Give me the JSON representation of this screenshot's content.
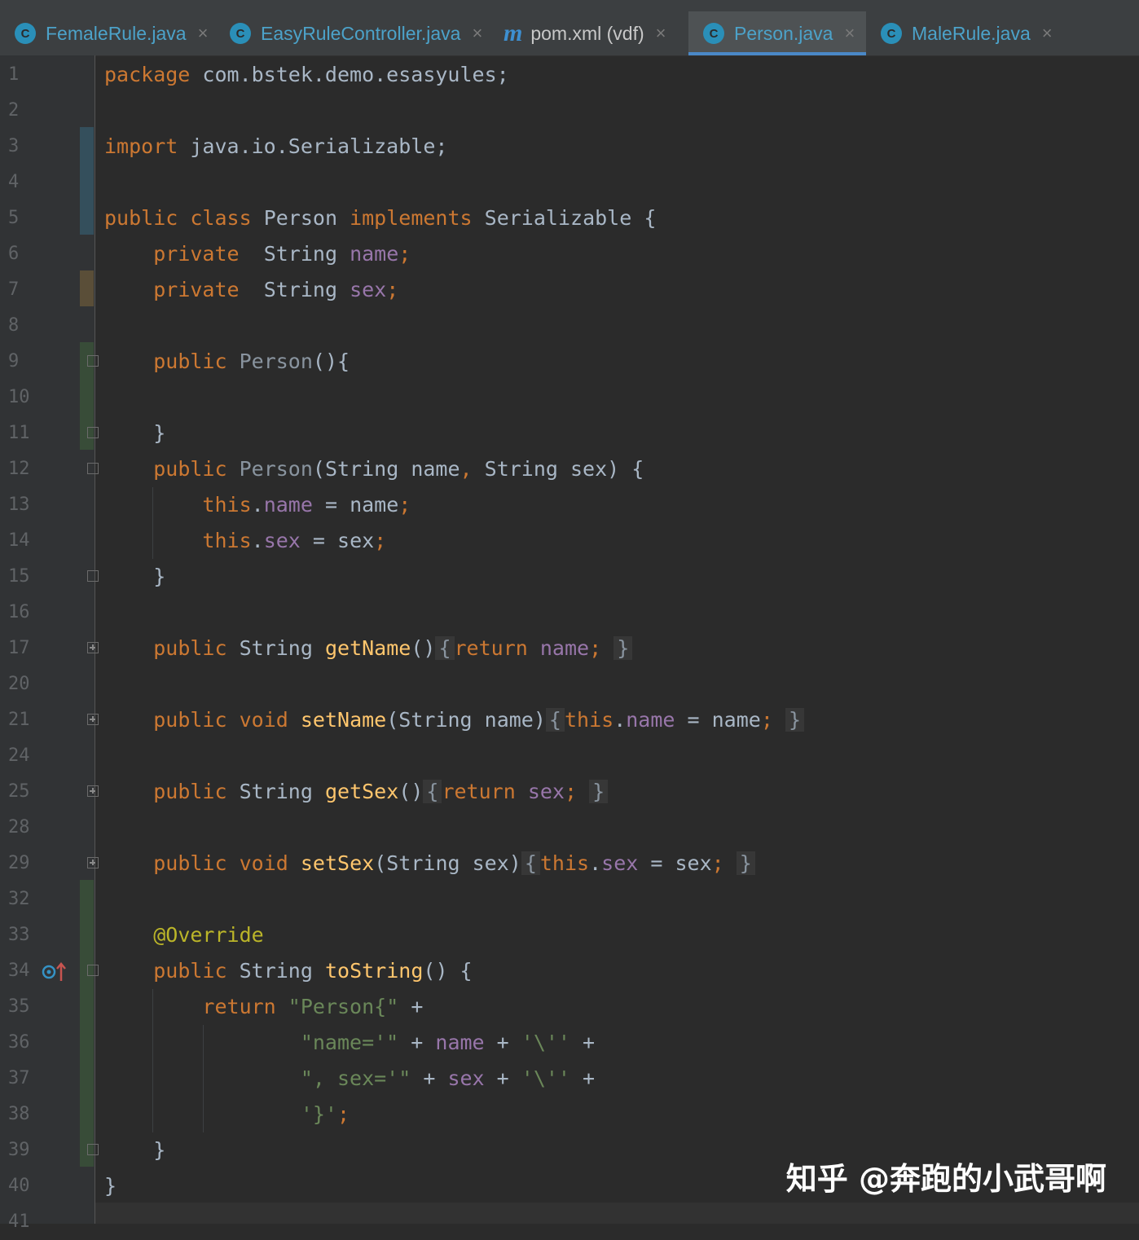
{
  "tabs": [
    {
      "label": "FemaleRule.java",
      "icon": "class-icon",
      "active": false
    },
    {
      "label": "EasyRuleController.java",
      "icon": "class-icon",
      "active": false
    },
    {
      "label": "pom.xml (vdf)",
      "icon": "maven-icon",
      "active": false
    },
    {
      "label": "Person.java",
      "icon": "class-icon",
      "active": true
    },
    {
      "label": "MaleRule.java",
      "icon": "class-icon",
      "active": false
    }
  ],
  "tab_icon_letter": "C",
  "maven_icon_letter": "m",
  "close_glyph": "×",
  "line_numbers": [
    "1",
    "2",
    "3",
    "4",
    "5",
    "6",
    "7",
    "8",
    "9",
    "10",
    "11",
    "12",
    "13",
    "14",
    "15",
    "16",
    "17",
    "20",
    "21",
    "24",
    "25",
    "28",
    "29",
    "32",
    "33",
    "34",
    "35",
    "36",
    "37",
    "38",
    "39",
    "40",
    "41"
  ],
  "code": {
    "pkg_kw": "package",
    "pkg_name": " com.bstek.demo.esasyules;",
    "imp_kw": "import",
    "imp_name": " java.io.Serializable;",
    "cls_public": "public",
    "cls_class": "class",
    "cls_name": "Person",
    "cls_impl": "implements",
    "cls_iface": "Serializable {",
    "private": "private",
    "string": "String",
    "name": "name",
    "sex": "sex",
    "semi": ";",
    "ctor_public": "public",
    "ctor_name": "Person",
    "ctor_empty": "(){",
    "close_brace": "}",
    "ctor2_sig_a": "(String name",
    "comma": ",",
    "ctor2_sig_b": " String sex) {",
    "this": "this",
    "dot": ".",
    "assign_name": " = name",
    "assign_sex": " = sex",
    "getName": "getName",
    "setName": "setName",
    "getSex": "getSex",
    "setSex": "setSex",
    "void": "void",
    "return": "return",
    "empty_parens": "()",
    "open_brace": "{",
    "space_close_brace": "}",
    "setName_params": "(String name)",
    "setSex_params": "(String sex)",
    "override": "@Override",
    "toString": "toString",
    "toString_tail": "() {",
    "str_person": "\"Person{\"",
    "plus": " +",
    "str_name_eq": "\"name='\"",
    "str_sex_eq": "\", sex='\"",
    "str_quote": "'\\''",
    "str_close": "'}'"
  },
  "gutter_icon": "override-method-icon",
  "watermark": "知乎 @奔跑的小武哥啊",
  "colors": {
    "background": "#2b2b2b",
    "keyword": "#cc7832",
    "field": "#9876aa",
    "method": "#ffc66d",
    "string": "#6a8759",
    "annotation": "#bbb529",
    "text": "#a9b7c6",
    "tab_text": "#4ca2c9"
  }
}
